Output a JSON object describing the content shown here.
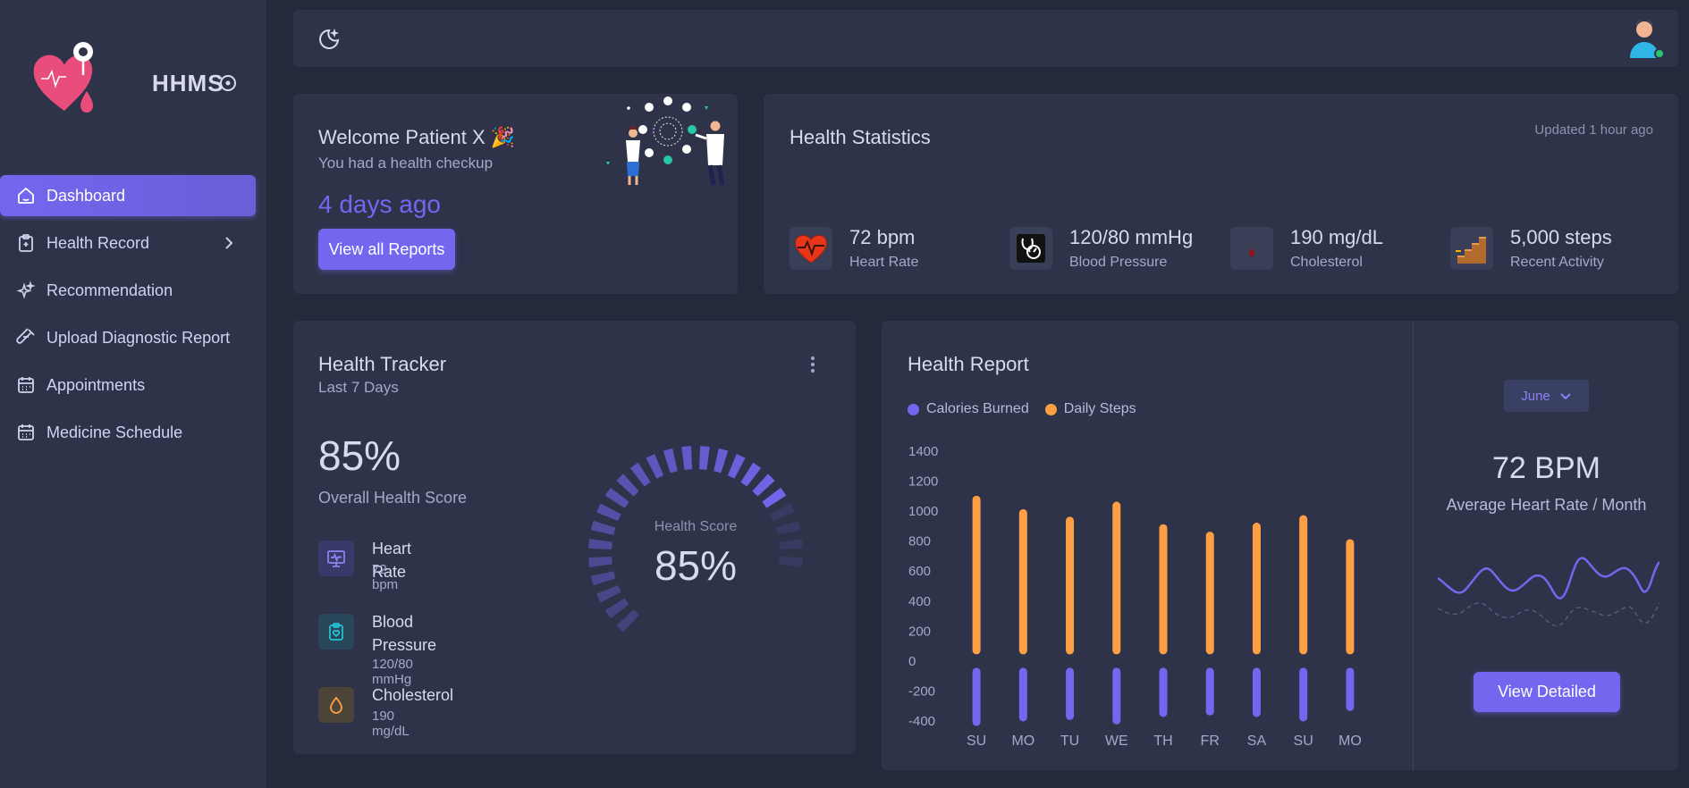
{
  "app": {
    "name": "HHMS"
  },
  "sidebar": {
    "items": [
      {
        "label": "Dashboard",
        "icon": "home-icon",
        "active": true
      },
      {
        "label": "Health Record",
        "icon": "clipboard-icon",
        "has_submenu": true
      },
      {
        "label": "Recommendation",
        "icon": "sparkles-icon"
      },
      {
        "label": "Upload Diagnostic Report",
        "icon": "test-tube-icon"
      },
      {
        "label": "Appointments",
        "icon": "calendar-icon"
      },
      {
        "label": "Medicine Schedule",
        "icon": "calendar-icon"
      }
    ]
  },
  "welcome": {
    "title": "Welcome Patient X 🎉",
    "subtitle": "You had a health checkup",
    "days": "4 days ago",
    "button": "View all Reports"
  },
  "stats": {
    "title": "Health Statistics",
    "updated": "Updated 1 hour ago",
    "items": [
      {
        "value": "72 bpm",
        "label": "Heart Rate",
        "icon": "heart-icon"
      },
      {
        "value": "120/80 mmHg",
        "label": "Blood Pressure",
        "icon": "stethoscope-icon"
      },
      {
        "value": "190 mg/dL",
        "label": "Cholesterol",
        "icon": "drop-icon"
      },
      {
        "value": "5,000 steps",
        "label": "Recent Activity",
        "icon": "stairs-icon"
      }
    ]
  },
  "tracker": {
    "title": "Health Tracker",
    "subtitle": "Last 7 Days",
    "score": "85%",
    "score_label": "Overall Health Score",
    "gauge_label": "Health Score",
    "gauge_value": "85%",
    "gauge_fraction": 0.85,
    "metrics": [
      {
        "title": "Heart Rate",
        "value": "72 bpm",
        "icon": "monitor-icon"
      },
      {
        "title": "Blood Pressure",
        "value": "120/80 mmHg",
        "icon": "clipboard-heart-icon"
      },
      {
        "title": "Cholesterol",
        "value": "190 mg/dL",
        "icon": "drop-icon"
      }
    ]
  },
  "report": {
    "title": "Health Report",
    "month": "June",
    "bpm": "72 BPM",
    "bpm_label": "Average Heart Rate / Month",
    "button": "View Detailed"
  },
  "colors": {
    "accent": "#7367f0",
    "steps": "#ff9f43",
    "calories": "#7367f0"
  },
  "chart_data": {
    "type": "bar",
    "categories": [
      "SU",
      "MO",
      "TU",
      "WE",
      "TH",
      "FR",
      "SA",
      "SU",
      "MO"
    ],
    "series": [
      {
        "name": "Calories Burned",
        "values": [
          -430,
          -400,
          -390,
          -420,
          -370,
          -360,
          -370,
          -400,
          -330
        ]
      },
      {
        "name": "Daily Steps",
        "values": [
          1100,
          1010,
          960,
          1060,
          910,
          860,
          920,
          970,
          810
        ]
      }
    ],
    "yticks": [
      "1400",
      "1200",
      "1000",
      "800",
      "600",
      "400",
      "200",
      "0",
      "-200",
      "-400"
    ],
    "ylim": [
      -400,
      1400
    ],
    "legend": "top-left"
  }
}
